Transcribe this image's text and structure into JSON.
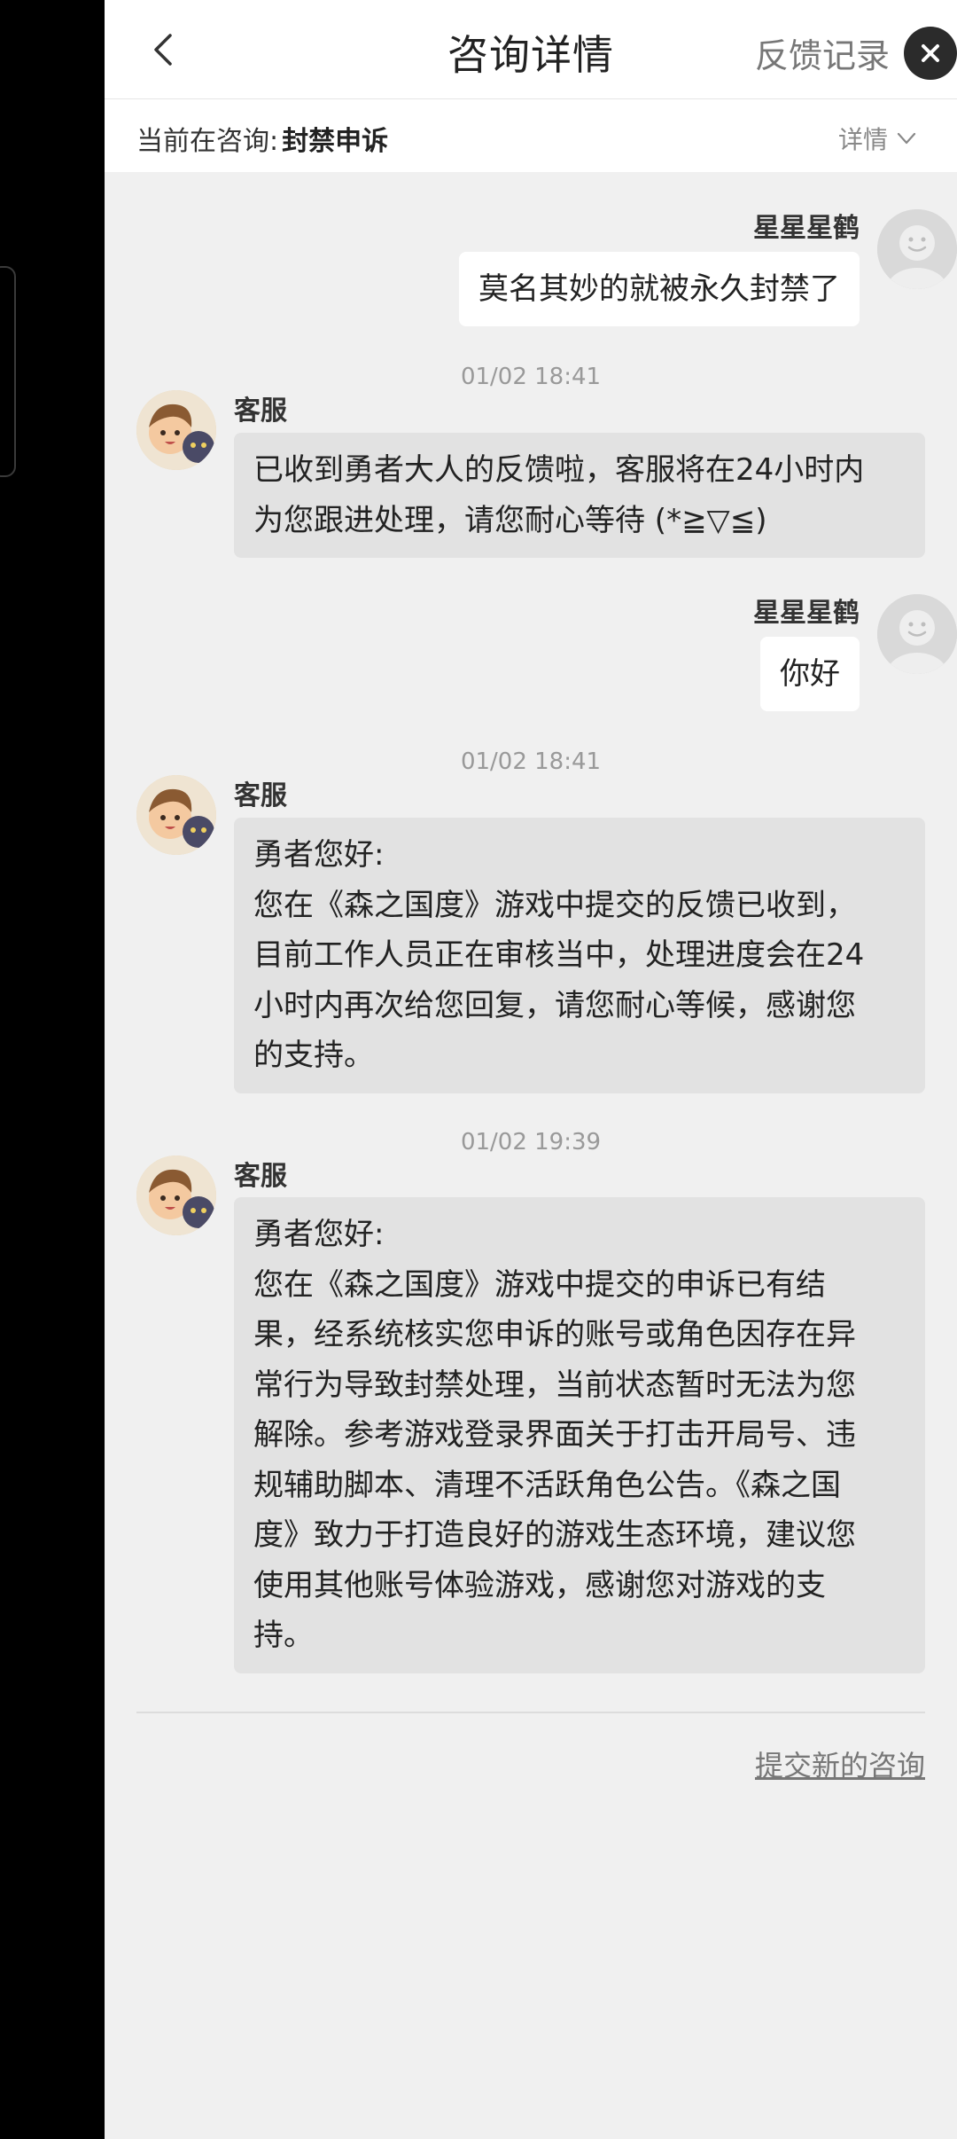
{
  "header": {
    "title": "咨询详情",
    "feedback_label": "反馈记录"
  },
  "subheader": {
    "current_label": "当前在咨询:",
    "current_value": "封禁申诉",
    "detail_label": "详情"
  },
  "messages": [
    {
      "type": "user",
      "name": "星星星鹤",
      "text": "莫名其妙的就被永久封禁了"
    },
    {
      "type": "agent",
      "time": "01/02 18:41",
      "name": "客服",
      "lines": [
        "已收到勇者大人的反馈啦，客服将在24小时内",
        "为您跟进处理，请您耐心等待 (*≧▽≦)"
      ]
    },
    {
      "type": "user",
      "name": "星星星鹤",
      "text": "你好"
    },
    {
      "type": "agent",
      "time": "01/02 18:41",
      "name": "客服",
      "lines": [
        "勇者您好:",
        "您在《森之国度》游戏中提交的反馈已收到，",
        "目前工作人员正在审核当中，处理进度会在24",
        "小时内再次给您回复，请您耐心等候，感谢您",
        "的支持。"
      ]
    },
    {
      "type": "agent",
      "time": "01/02 19:39",
      "name": "客服",
      "lines": [
        "勇者您好:",
        "您在《森之国度》游戏中提交的申诉已有结",
        "果，经系统核实您申诉的账号或角色因存在异",
        "常行为导致封禁处理，当前状态暂时无法为您",
        "解除。参考游戏登录界面关于打击开局号、违",
        "规辅助脚本、清理不活跃角色公告。《森之国",
        "度》致力于打造良好的游戏生态环境，建议您",
        "使用其他账号体验游戏，感谢您对游戏的支",
        "持。"
      ]
    }
  ],
  "footer": {
    "new_consult_label": "提交新的咨询"
  },
  "colors": {
    "panel_bg": "#f0f0f0",
    "user_bubble": "#ffffff",
    "agent_bubble": "#e2e2e2",
    "close_button": "#2b2b2b"
  }
}
